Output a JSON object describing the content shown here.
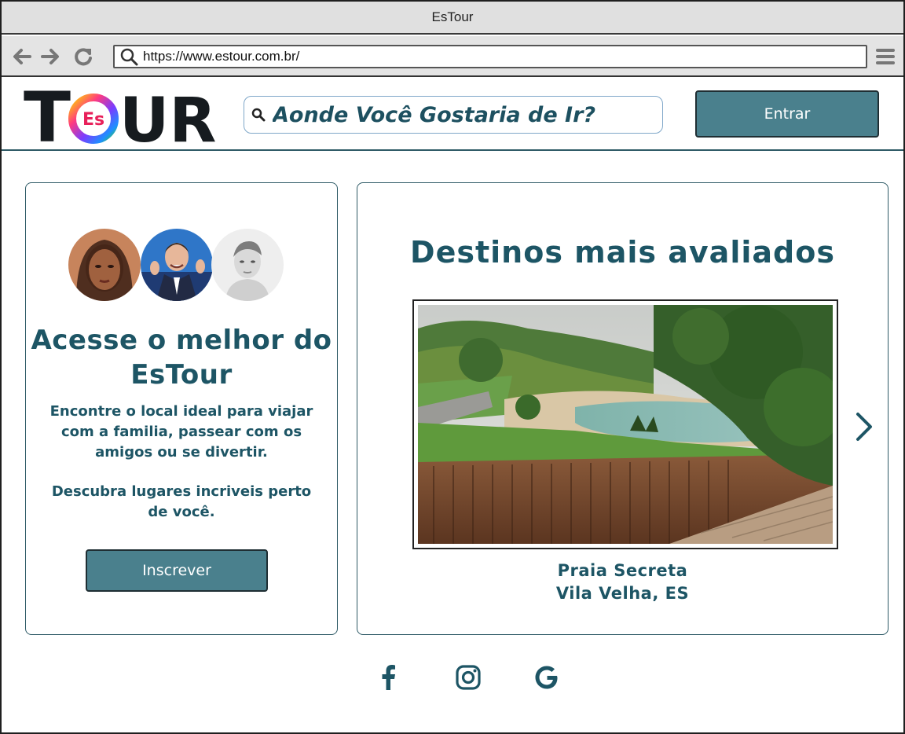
{
  "browser": {
    "window_title": "EsTour",
    "url": "https://www.estour.com.br/",
    "icons": [
      "back-icon",
      "forward-icon",
      "reload-icon",
      "search-icon",
      "menu-icon"
    ]
  },
  "header": {
    "logo_text": "EsTour",
    "search_placeholder": "Aonde Você Gostaria de Ir?",
    "login_label": "Entrar"
  },
  "promo": {
    "title": "Acesse o melhor do EsTour",
    "description": "Encontre o local ideal para viajar com a familia, passear com os amigos ou se divertir.",
    "description2": "Descubra lugares incriveis perto de você.",
    "signup_label": "Inscrever"
  },
  "destinations": {
    "title": "Destinos mais avaliados",
    "featured": {
      "name": "Praia Secreta",
      "location": "Vila Velha, ES"
    }
  },
  "footer": {
    "social": [
      "facebook-icon",
      "instagram-icon",
      "google-icon"
    ]
  },
  "colors": {
    "accent": "#4a808d",
    "text": "#1d5565",
    "chrome": "#e0e0e0"
  }
}
